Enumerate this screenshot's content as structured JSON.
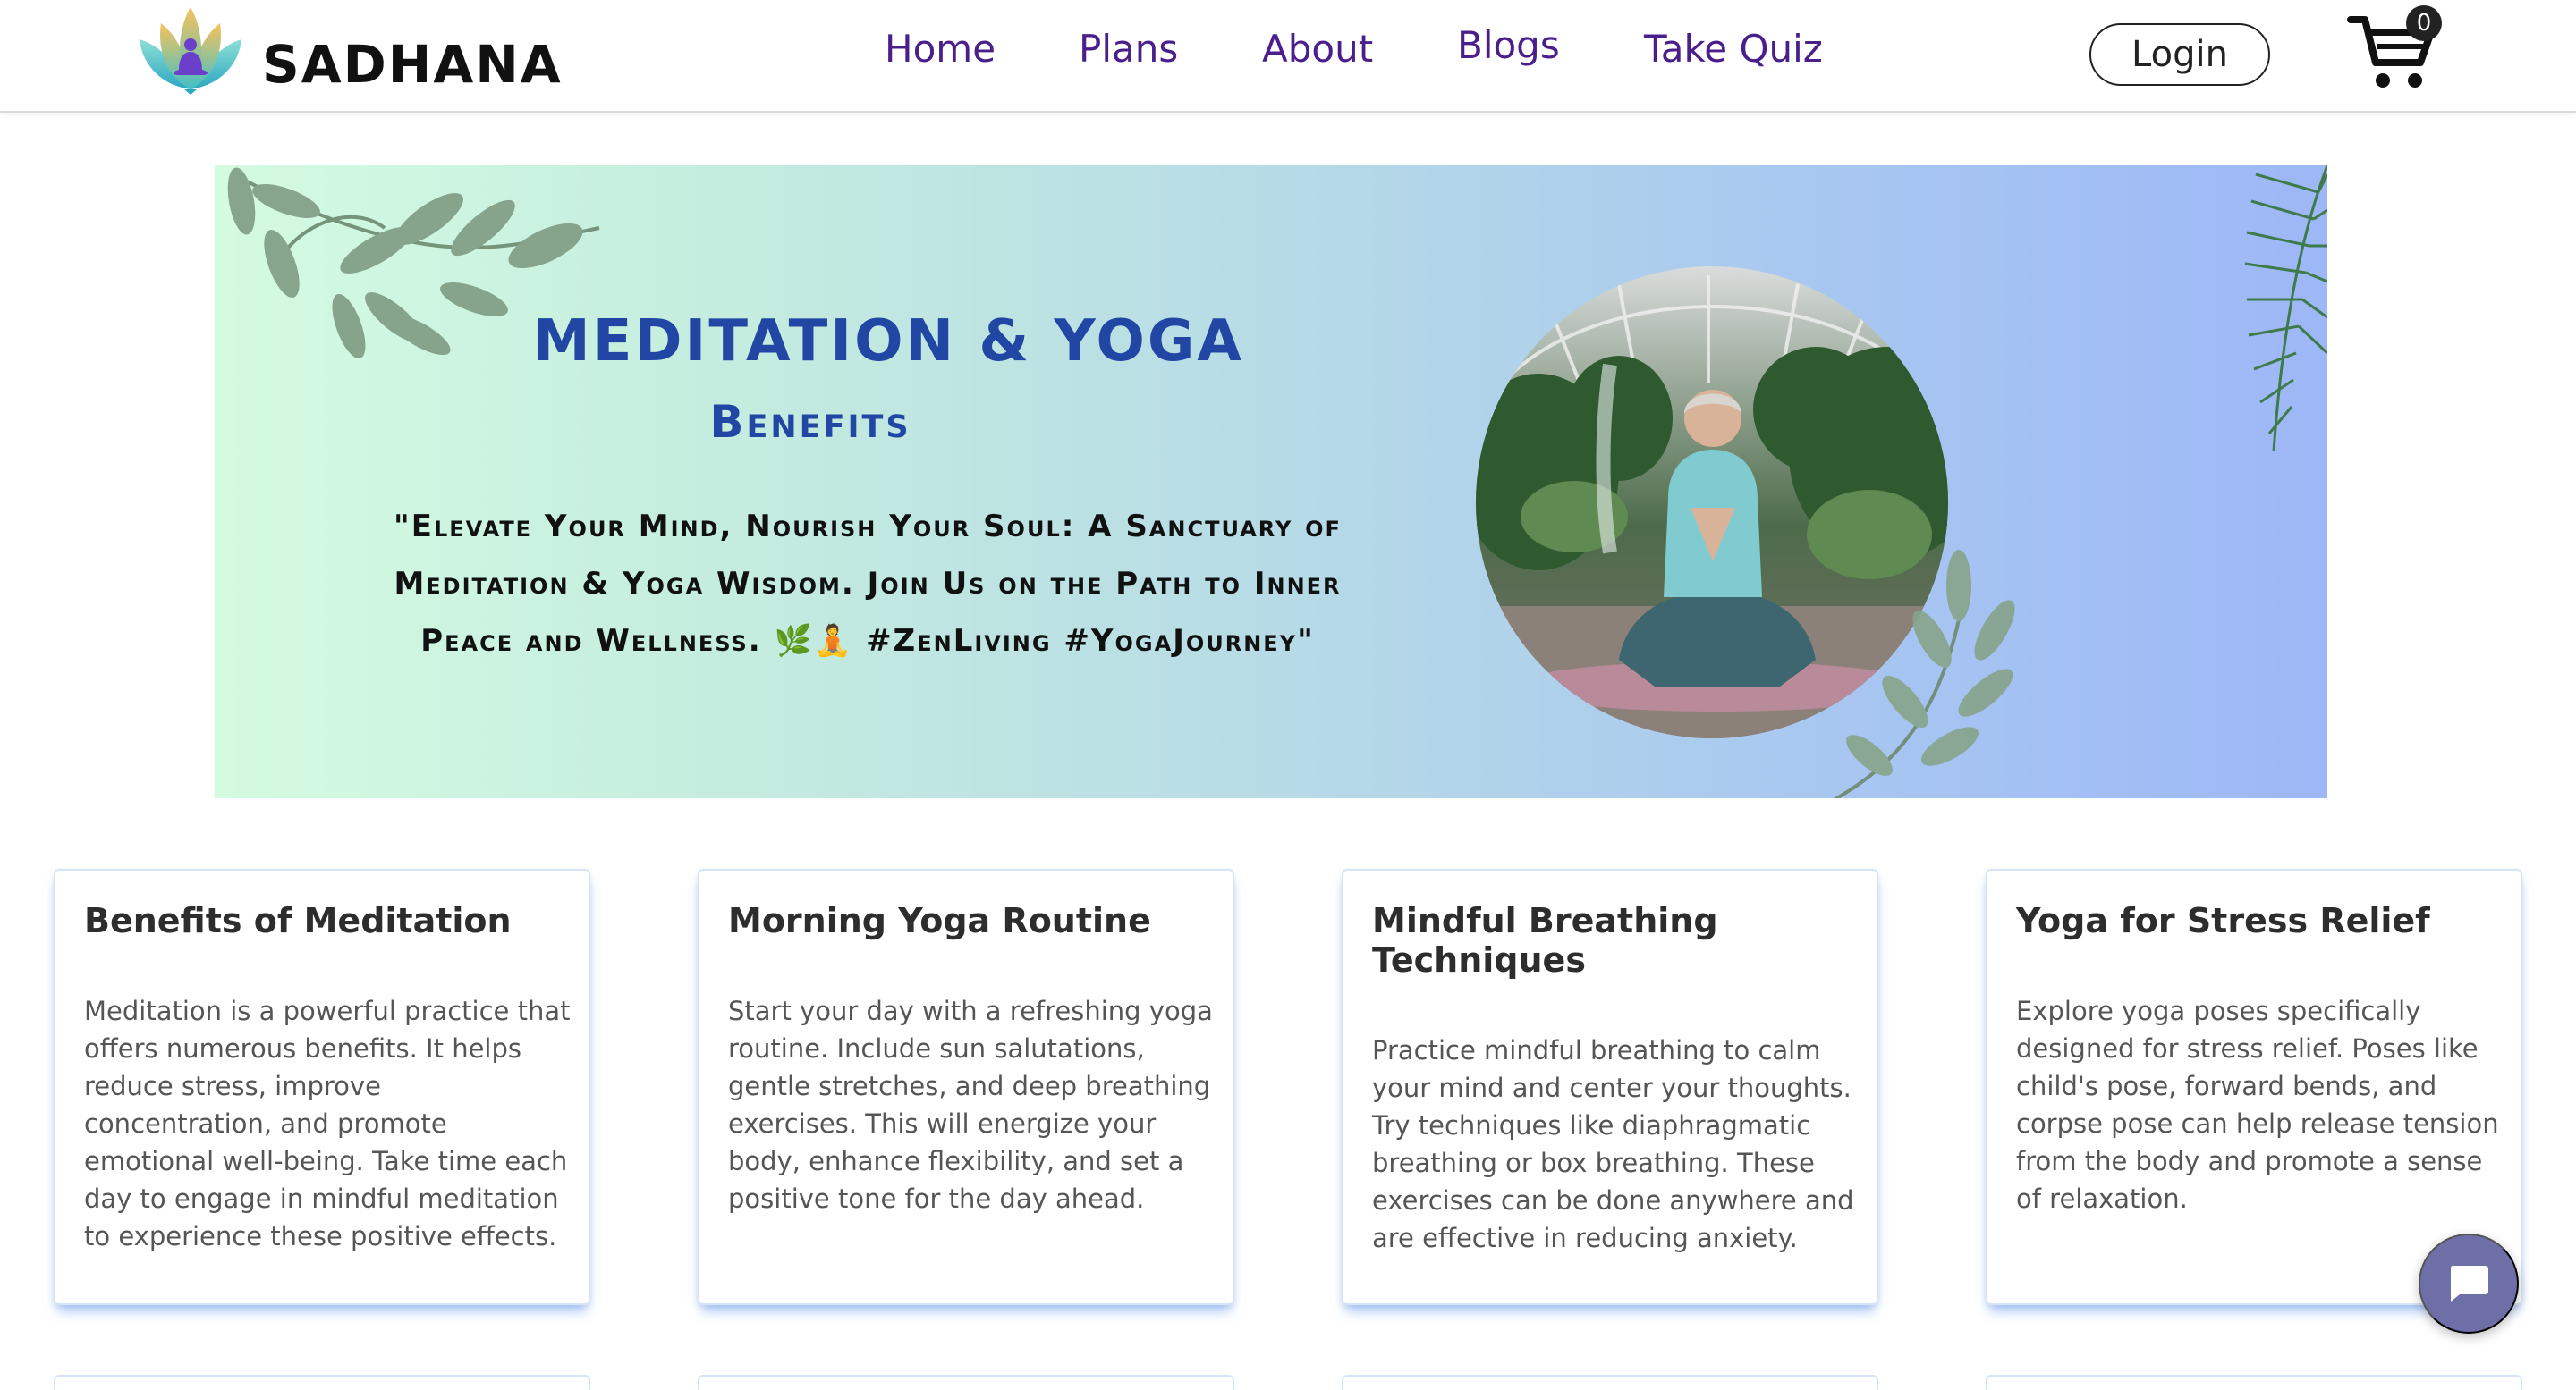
{
  "brand": {
    "name": "SADHANA"
  },
  "nav": {
    "links": [
      {
        "label": "Home"
      },
      {
        "label": "Plans"
      },
      {
        "label": "About"
      },
      {
        "label": "Blogs"
      },
      {
        "label": "Take Quiz"
      }
    ],
    "login_label": "Login",
    "cart_count": "0"
  },
  "hero": {
    "title": "MEDITATION & YOGA",
    "subtitle": "Benefits",
    "quote": "\"Elevate Your Mind, Nourish Your Soul: A Sanctuary of Meditation & Yoga Wisdom. Join Us on the Path to Inner Peace and Wellness. 🌿🧘 #ZenLiving #YogaJourney\""
  },
  "cards": [
    {
      "title": "Benefits of Meditation",
      "body": "Meditation is a powerful practice that offers numerous benefits. It helps reduce stress, improve concentration, and promote emotional well-being. Take time each day to engage in mindful meditation to experience these positive effects."
    },
    {
      "title": "Morning Yoga Routine",
      "body": "Start your day with a refreshing yoga routine. Include sun salutations, gentle stretches, and deep breathing exercises. This will energize your body, enhance flexibility, and set a positive tone for the day ahead."
    },
    {
      "title": "Mindful Breathing Techniques",
      "body": "Practice mindful breathing to calm your mind and center your thoughts. Try techniques like diaphragmatic breathing or box breathing. These exercises can be done anywhere and are effective in reducing anxiety."
    },
    {
      "title": "Yoga for Stress Relief",
      "body": "Explore yoga poses specifically designed for stress relief. Poses like child's pose, forward bends, and corpse pose can help release tension from the body and promote a sense of relaxation."
    }
  ],
  "icons": {
    "logo": "lotus-meditation-logo-icon",
    "cart": "shopping-cart-icon",
    "chat": "chat-bubble-icon"
  },
  "colors": {
    "nav_link": "#4a1f8c",
    "hero_heading": "#2146a3",
    "hero_gradient_start": "#d4fbe0",
    "hero_gradient_end": "#9db7f7",
    "card_shadow": "#508cf0",
    "chat_button": "#6f6fa8"
  }
}
